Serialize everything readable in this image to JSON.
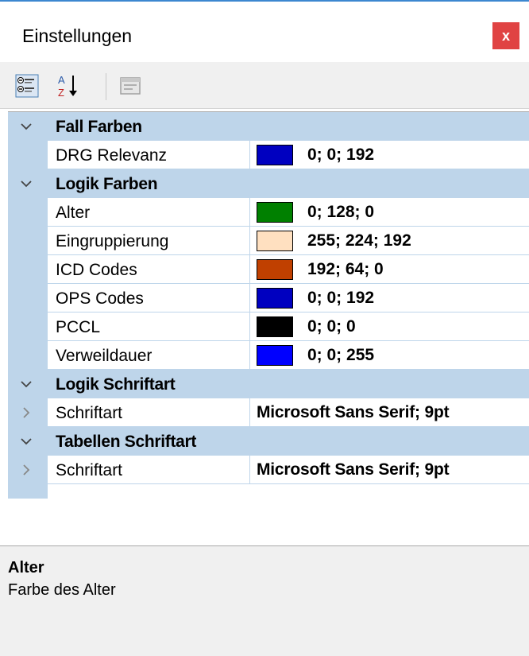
{
  "window": {
    "title": "Einstellungen",
    "close_label": "x"
  },
  "toolbar": {
    "categorized_icon": "categorized-view-icon",
    "alphabetical_icon": "alphabetical-sort-icon",
    "property_pages_icon": "property-pages-icon"
  },
  "grid": {
    "categories": [
      {
        "label": "Fall Farben",
        "expanded": true,
        "properties": [
          {
            "name": "DRG Relevanz",
            "value": "0; 0; 192",
            "color": "#0000c0"
          }
        ]
      },
      {
        "label": "Logik Farben",
        "expanded": true,
        "properties": [
          {
            "name": "Alter",
            "value": "0; 128; 0",
            "color": "#008000"
          },
          {
            "name": "Eingruppierung",
            "value": "255; 224; 192",
            "color": "#ffe0c0"
          },
          {
            "name": "ICD Codes",
            "value": "192; 64; 0",
            "color": "#c04000"
          },
          {
            "name": "OPS Codes",
            "value": "0; 0; 192",
            "color": "#0000c0"
          },
          {
            "name": "PCCL",
            "value": "0; 0; 0",
            "color": "#000000"
          },
          {
            "name": "Verweildauer",
            "value": "0; 0; 255",
            "color": "#0000ff"
          }
        ]
      },
      {
        "label": "Logik Schriftart",
        "expanded": true,
        "properties": [
          {
            "name": "Schriftart",
            "value": "Microsoft Sans Serif; 9pt",
            "expandable": true
          }
        ]
      },
      {
        "label": "Tabellen Schriftart",
        "expanded": true,
        "properties": [
          {
            "name": "Schriftart",
            "value": "Microsoft Sans Serif; 9pt",
            "expandable": true
          }
        ]
      }
    ]
  },
  "description": {
    "title": "Alter",
    "text": "Farbe des Alter"
  },
  "colors": {
    "margin": "#bed5ea",
    "close_button": "#e04343",
    "accent_line": "#3c87d0"
  }
}
